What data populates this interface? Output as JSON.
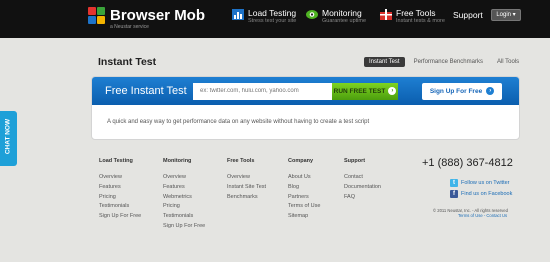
{
  "brand": {
    "name": "Browser Mob",
    "tagline": "a Neustar service"
  },
  "nav": {
    "items": [
      {
        "title": "Load Testing",
        "subtitle": "Stress test your site"
      },
      {
        "title": "Monitoring",
        "subtitle": "Guarantee uptime"
      },
      {
        "title": "Free Tools",
        "subtitle": "Instant tests & more"
      }
    ],
    "support": "Support",
    "login": "Login"
  },
  "page": {
    "title": "Instant Test",
    "tabs": [
      "Instant Test",
      "Performance Benchmarks",
      "All Tools"
    ]
  },
  "test_panel": {
    "title": "Free Instant Test",
    "placeholder": "ex: twitter.com, hulu.com, yahoo.com",
    "run_label": "RUN FREE TEST",
    "signup_label": "Sign Up For Free",
    "description": "A quick and easy way to get performance data on any website without having to create a test script"
  },
  "chat": "CHAT NOW",
  "footer": {
    "columns": [
      {
        "heading": "Load Testing",
        "links": [
          "Overview",
          "Features",
          "Pricing",
          "Testimonials",
          "Sign Up For Free"
        ]
      },
      {
        "heading": "Monitoring",
        "links": [
          "Overview",
          "Features",
          "Webmetrics",
          "Pricing",
          "Testimonials",
          "Sign Up For Free"
        ]
      },
      {
        "heading": "Free Tools",
        "links": [
          "Overview",
          "Instant Site Test",
          "Benchmarks"
        ]
      },
      {
        "heading": "Company",
        "links": [
          "About Us",
          "Blog",
          "Partners",
          "Terms of Use",
          "Sitemap"
        ]
      },
      {
        "heading": "Support",
        "links": [
          "Contact",
          "Documentation",
          "FAQ"
        ]
      }
    ],
    "phone": "+1 (888) 367-4812",
    "twitter": "Follow us on Twitter",
    "facebook": "Find us on Facebook",
    "copyright": "© 2011 Neustar, Inc. - All rights reserved",
    "legal": "Terms of Use - Contact Us"
  },
  "colors": {
    "accent": "#1e7fd2",
    "run": "#7ed321",
    "chat": "#1ea0d8"
  }
}
